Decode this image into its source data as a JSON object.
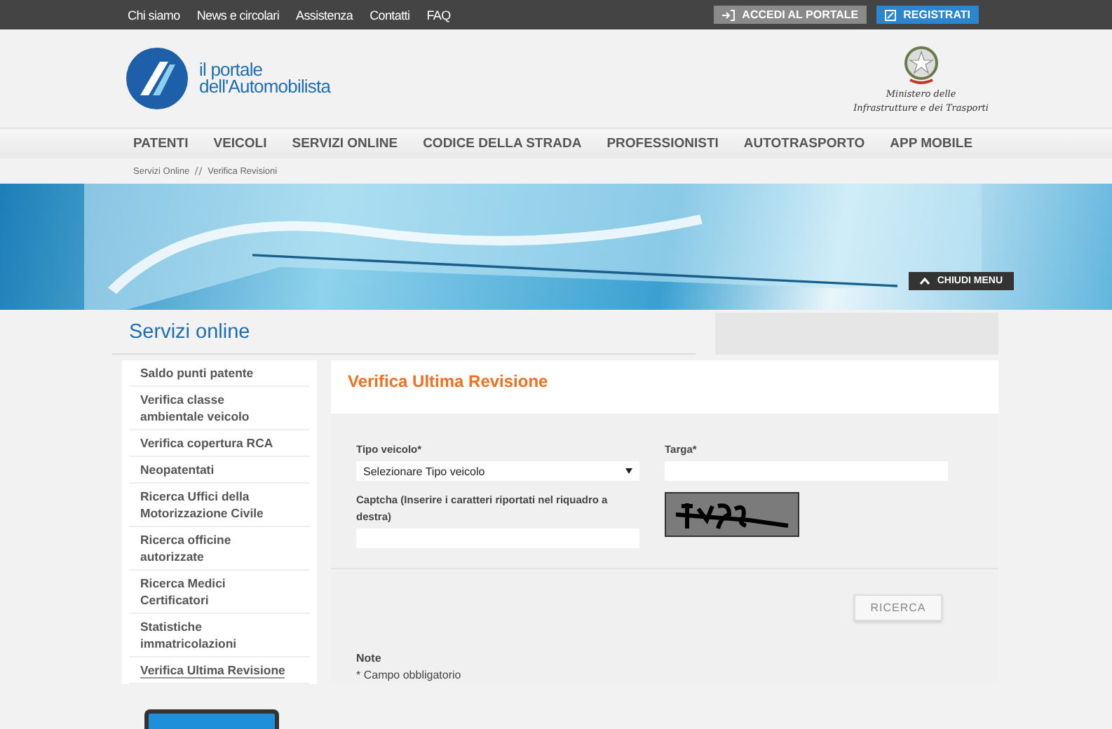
{
  "top_bar": {
    "links": [
      "Chi siamo",
      "News e circolari",
      "Assistenza",
      "Contatti",
      "FAQ"
    ],
    "buttons": [
      {
        "kind": "login",
        "label": "ACCEDI AL PORTALE"
      },
      {
        "kind": "register",
        "label": "REGISTRATI"
      }
    ]
  },
  "header": {
    "logo_lines": [
      "il portale",
      "dell'Automobilista"
    ],
    "ministry_lines": [
      "Ministero delle",
      "Infrastrutture e dei Trasporti"
    ]
  },
  "nav": [
    "PATENTI",
    "VEICOLI",
    "SERVIZI ONLINE",
    "CODICE DELLA STRADA",
    "PROFESSIONISTI",
    "AUTOTRASPORTO",
    "APP MOBILE"
  ],
  "breadcrumb": [
    "Servizi Online",
    "Verifica Revisioni"
  ],
  "banner": {
    "close_menu": "CHIUDI MENU"
  },
  "section_title": "Servizi online",
  "sidebar": [
    {
      "label": "Saldo punti patente",
      "selected": false
    },
    {
      "label": "Verifica classe ambientale veicolo",
      "selected": false
    },
    {
      "label": "Verifica copertura RCA",
      "selected": false
    },
    {
      "label": "Neopatentati",
      "selected": false
    },
    {
      "label": "Ricerca Uffici della Motorizzazione Civile",
      "selected": false
    },
    {
      "label": "Ricerca officine autorizzate",
      "selected": false
    },
    {
      "label": "Ricerca Medici Certificatori",
      "selected": false
    },
    {
      "label": "Statistiche immatricolazioni",
      "selected": false
    },
    {
      "label": "Verifica Ultima Revisione",
      "selected": true
    }
  ],
  "form": {
    "title": "Verifica Ultima Revisione",
    "vehicle_type": {
      "label": "Tipo veicolo*",
      "value": "Selezionare Tipo veicolo"
    },
    "plate": {
      "label": "Targa*"
    },
    "captcha": {
      "label": "Captcha (Inserire i caratteri riportati nel riquadro a destra)"
    },
    "search_button": "RICERCA",
    "notes_title": "Note",
    "notes": "* Campo obbligatorio"
  }
}
